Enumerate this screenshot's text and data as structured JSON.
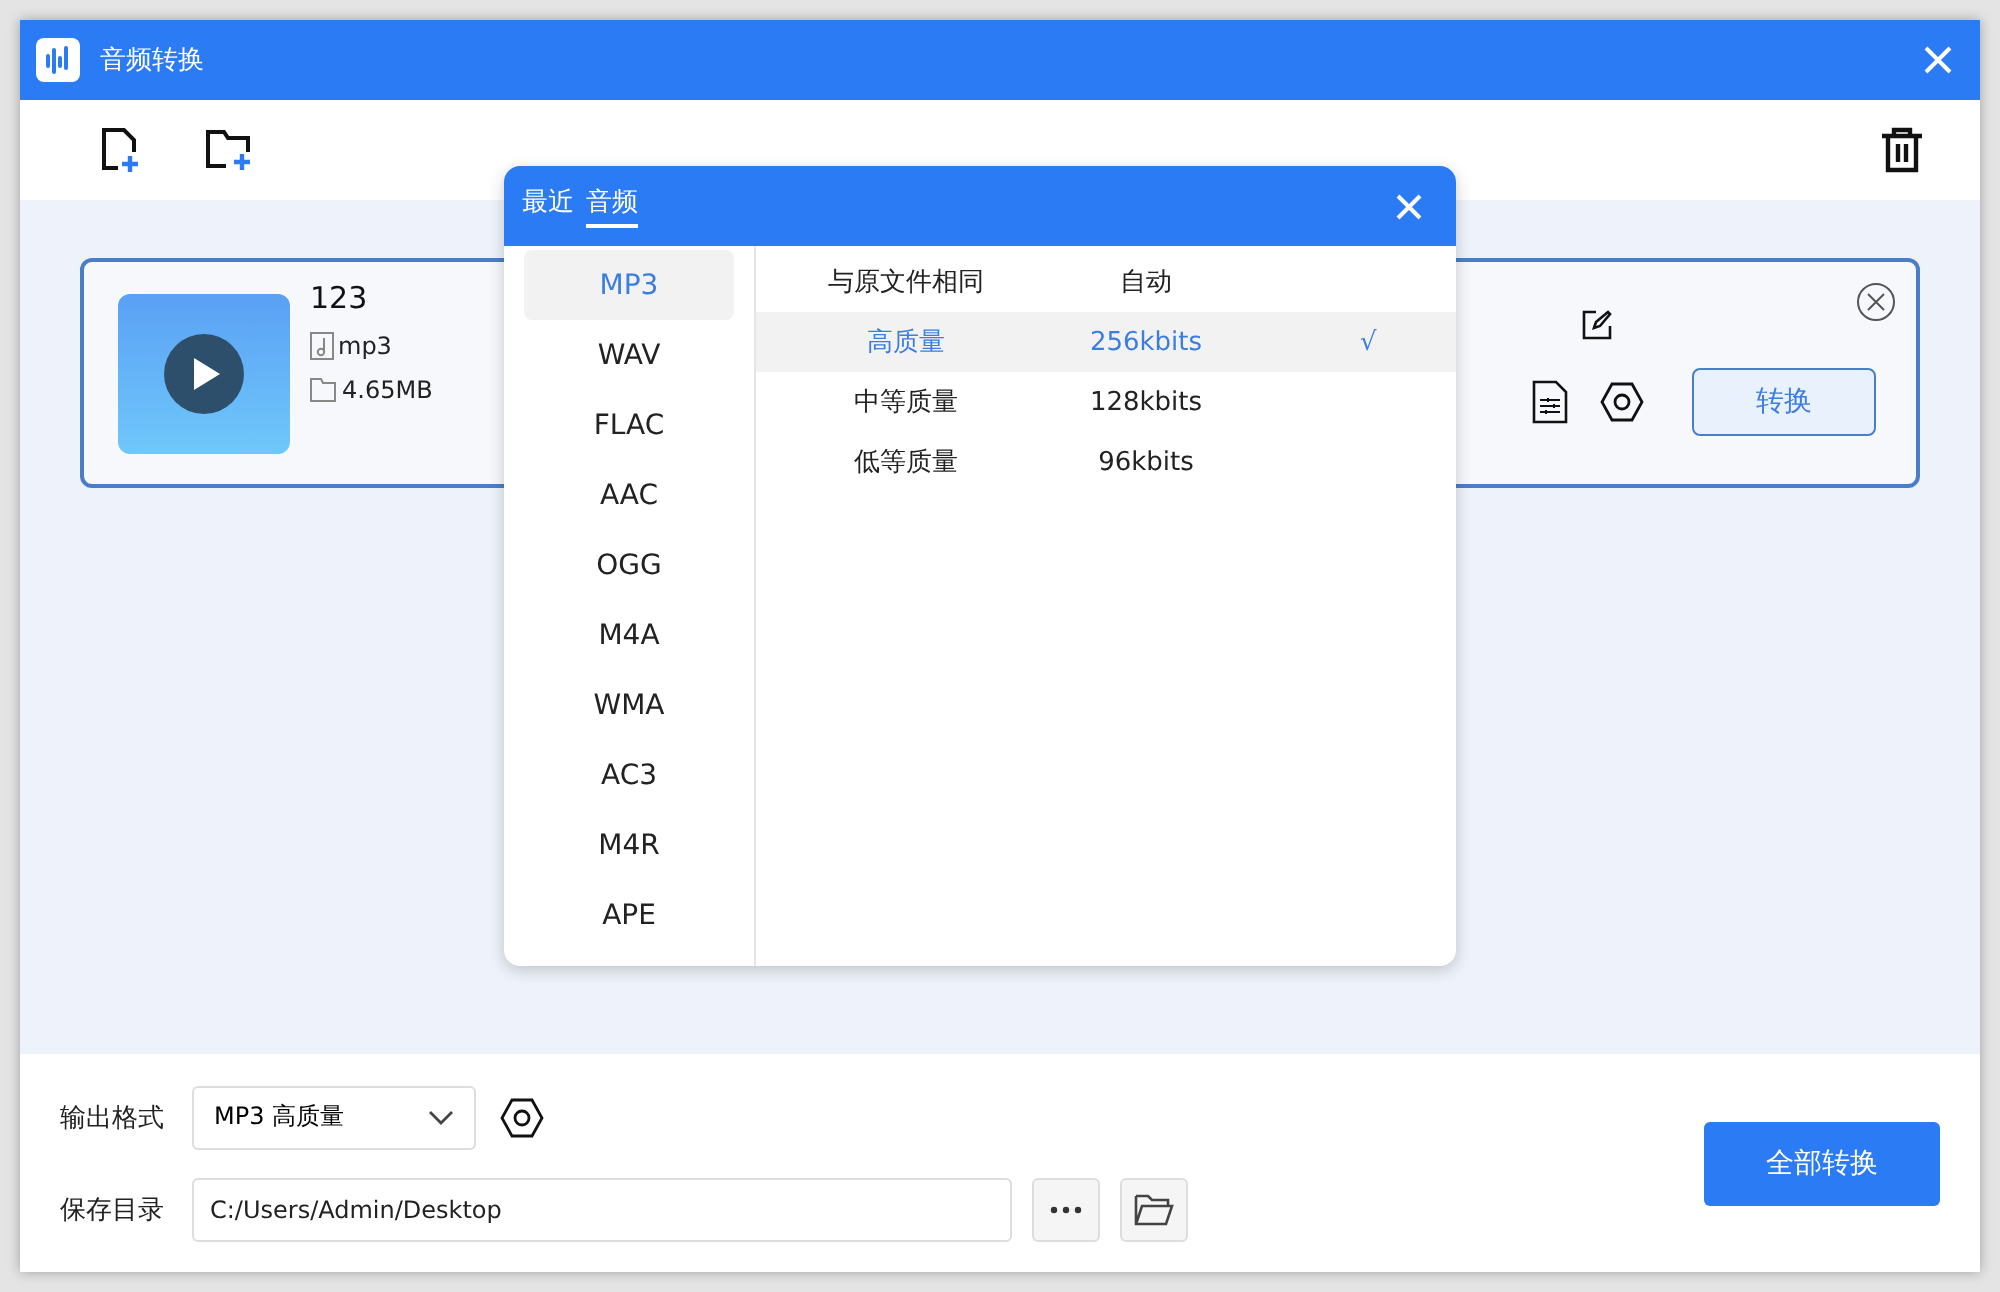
{
  "window": {
    "title": "音频转换"
  },
  "file_card": {
    "name": "123",
    "format": "mp3",
    "size": "4.65MB",
    "convert_button": "转换"
  },
  "format_popup": {
    "tabs": [
      {
        "label": "最近",
        "selected": false
      },
      {
        "label": "音频",
        "selected": true
      }
    ],
    "formats": [
      {
        "label": "MP3",
        "selected": true
      },
      {
        "label": "WAV",
        "selected": false
      },
      {
        "label": "FLAC",
        "selected": false
      },
      {
        "label": "AAC",
        "selected": false
      },
      {
        "label": "OGG",
        "selected": false
      },
      {
        "label": "M4A",
        "selected": false
      },
      {
        "label": "WMA",
        "selected": false
      },
      {
        "label": "AC3",
        "selected": false
      },
      {
        "label": "M4R",
        "selected": false
      },
      {
        "label": "APE",
        "selected": false
      }
    ],
    "qualities": [
      {
        "name": "与原文件相同",
        "bitrate": "自动",
        "selected": false
      },
      {
        "name": "高质量",
        "bitrate": "256kbits",
        "selected": true,
        "mark": "√"
      },
      {
        "name": "中等质量",
        "bitrate": "128kbits",
        "selected": false
      },
      {
        "name": "低等质量",
        "bitrate": "96kbits",
        "selected": false
      }
    ]
  },
  "output_format": {
    "label": "输出格式",
    "value": "MP3 高质量"
  },
  "save_directory": {
    "label": "保存目录",
    "value": "C:/Users/Admin/Desktop"
  },
  "convert_all_button": "全部转换"
}
